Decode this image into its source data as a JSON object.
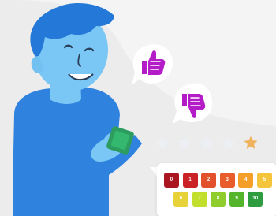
{
  "colors": {
    "background": "#ececec",
    "person_skin": "#79c7f5",
    "person_hair": "#2478d8",
    "person_shirt": "#2f83df",
    "phone": "#2d9d5f",
    "thumb_icon": "#b41cc7",
    "star_empty": "#eceff3",
    "star_selected": "#f1b25e"
  },
  "rating": {
    "stars": [
      {
        "icon": "star-icon",
        "selected": false
      },
      {
        "icon": "star-icon",
        "selected": false
      },
      {
        "icon": "star-icon",
        "selected": false
      },
      {
        "icon": "star-icon",
        "selected": false
      },
      {
        "icon": "star-icon",
        "selected": true
      }
    ]
  },
  "score_scale": {
    "top_row": [
      {
        "label": "0",
        "color": "#a9161f"
      },
      {
        "label": "1",
        "color": "#cb2228"
      },
      {
        "label": "2",
        "color": "#e2512b"
      },
      {
        "label": "3",
        "color": "#e85d2c"
      },
      {
        "label": "4",
        "color": "#f59e2a"
      },
      {
        "label": "5",
        "color": "#f4c43b"
      }
    ],
    "bottom_row": [
      {
        "label": "6",
        "color": "#e8d23a"
      },
      {
        "label": "7",
        "color": "#c2df2d"
      },
      {
        "label": "8",
        "color": "#8ecd2c"
      },
      {
        "label": "9",
        "color": "#54b52d"
      },
      {
        "label": "10",
        "color": "#2f9d3f"
      }
    ]
  }
}
